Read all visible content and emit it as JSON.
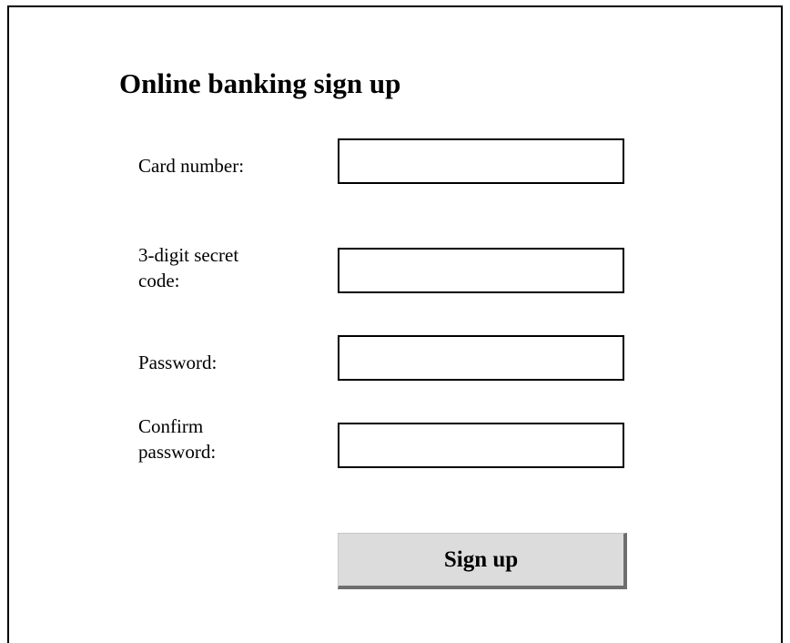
{
  "form": {
    "title": "Online banking sign up",
    "fields": [
      {
        "label": "Card number:",
        "value": "",
        "placeholder": ""
      },
      {
        "label_line1": "3-digit secret",
        "label_line2": "code:",
        "value": "",
        "placeholder": ""
      },
      {
        "label": "Password:",
        "value": "",
        "placeholder": ""
      },
      {
        "label_line1": "Confirm",
        "label_line2": "password:",
        "value": "",
        "placeholder": ""
      }
    ],
    "submit_label": "Sign up"
  }
}
